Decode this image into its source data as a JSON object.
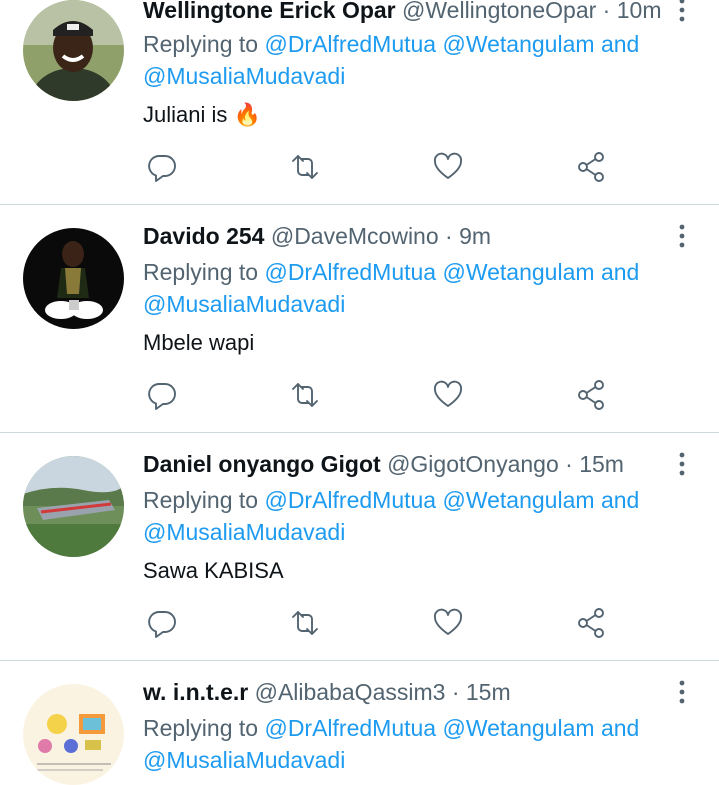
{
  "tweets": [
    {
      "name": "Wellingtone Erick Opar",
      "handle": "@WellingtoneOpar",
      "sep": "·",
      "time": "10m",
      "replying_label": "Replying to",
      "mention1": "@DrAlfredMutua",
      "mention2": "@Wetangulam",
      "and": "and",
      "mention3": "@MusaliaMudavadi",
      "text": "Juliani is",
      "emoji": "🔥"
    },
    {
      "name": "Davido 254",
      "handle": "@DaveMcowino",
      "sep": "·",
      "time": "9m",
      "replying_label": "Replying to",
      "mention1": "@DrAlfredMutua",
      "mention2": "@Wetangulam",
      "and": "and",
      "mention3": "@MusaliaMudavadi",
      "text": "Mbele wapi"
    },
    {
      "name": "Daniel onyango Gigot",
      "handle": "@GigotOnyango",
      "sep": "·",
      "time": "15m",
      "replying_label": "Replying to",
      "mention1": "@DrAlfredMutua",
      "mention2": "@Wetangulam",
      "and": "and",
      "mention3": "@MusaliaMudavadi",
      "text": "Sawa KABISA"
    },
    {
      "name": "w. i.n.t.e.r",
      "handle": "@AlibabaQassim3",
      "sep": "·",
      "time": "15m",
      "replying_label": "Replying to",
      "mention1": "@DrAlfredMutua",
      "mention2": "@Wetangulam",
      "and": "and",
      "mention3": "@MusaliaMudavadi"
    }
  ],
  "colors": {
    "link": "#1d9bf0",
    "secondary": "#536471",
    "divider": "#cfd9de"
  },
  "icons": {
    "reply": "reply-icon",
    "retweet": "retweet-icon",
    "like": "heart-icon",
    "share": "share-icon",
    "more": "more-vertical-icon"
  }
}
